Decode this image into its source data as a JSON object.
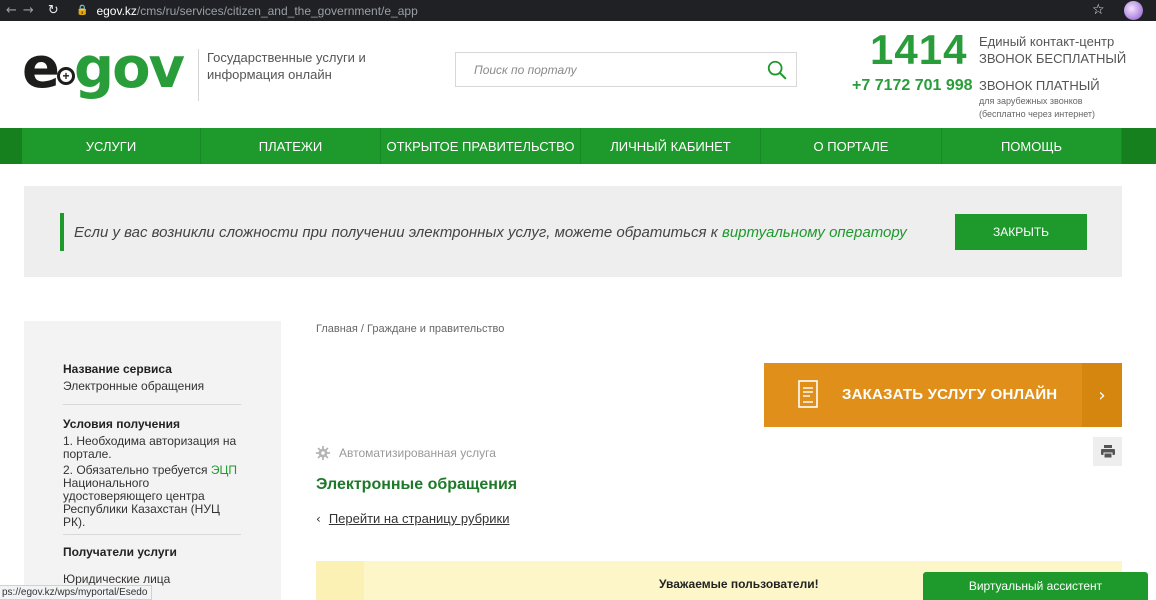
{
  "browser": {
    "url_host": "egov.kz",
    "url_path": "/cms/ru/services/citizen_and_the_government/e_app"
  },
  "header": {
    "logo_e": "e",
    "logo_plus": "+",
    "logo_gov": "gov",
    "tagline": "Государственные услуги и информация онлайн",
    "search_placeholder": "Поиск по порталу",
    "hotline_number": "1414",
    "hotline_label_1": "Единый контакт-центр",
    "hotline_label_2": "ЗВОНОК БЕСПЛАТНЫЙ",
    "paid_number": "+7 7172 701 998",
    "paid_label": "ЗВОНОК ПЛАТНЫЙ",
    "paid_note_1": "для зарубежных звонков",
    "paid_note_2": "(бесплатно через интернет)"
  },
  "nav": {
    "items": [
      {
        "label": "УСЛУГИ"
      },
      {
        "label": "ПЛАТЕЖИ"
      },
      {
        "label": "ОТКРЫТОЕ ПРАВИТЕЛЬСТВО"
      },
      {
        "label": "ЛИЧНЫЙ КАБИНЕТ"
      },
      {
        "label": "О ПОРТАЛЕ"
      },
      {
        "label": "ПОМОЩЬ"
      }
    ]
  },
  "notice": {
    "text": "Если у вас возникли сложности при получении электронных услуг, можете обратиться к ",
    "link": "виртуальному оператору",
    "close_label": "ЗАКРЫТЬ"
  },
  "sidebar": {
    "service_name_title": "Название сервиса",
    "service_name_value": "Электронные обращения",
    "conditions_title": "Условия получения",
    "condition_1": "1. Необходима авторизация на портале.",
    "condition_2_prefix": "2. Обязательно требуется ",
    "condition_2_link": "ЭЦП",
    "condition_2_suffix": " Национального удостоверяющего центра Республики Казахстан (НУЦ РК).",
    "recipients_title": "Получатели услуги",
    "recipients_value": "Юридические лица"
  },
  "main": {
    "breadcrumb": "Главная / Граждане и правительство",
    "order_label": "ЗАКАЗАТЬ УСЛУГУ ОНЛАЙН",
    "automated_label": "Автоматизированная услуга",
    "service_title": "Электронные обращения",
    "rubric_link": "Перейти на страницу рубрики",
    "announcement": "Уважаемые пользователи!"
  },
  "assistant_label": "Виртуальный ассистент",
  "status_url": "ps://egov.kz/wps/myportal/Esedo",
  "colors": {
    "brand_green": "#1e9a2d",
    "order_orange": "#e0901a",
    "announce_yellow": "#fcf6c8"
  }
}
